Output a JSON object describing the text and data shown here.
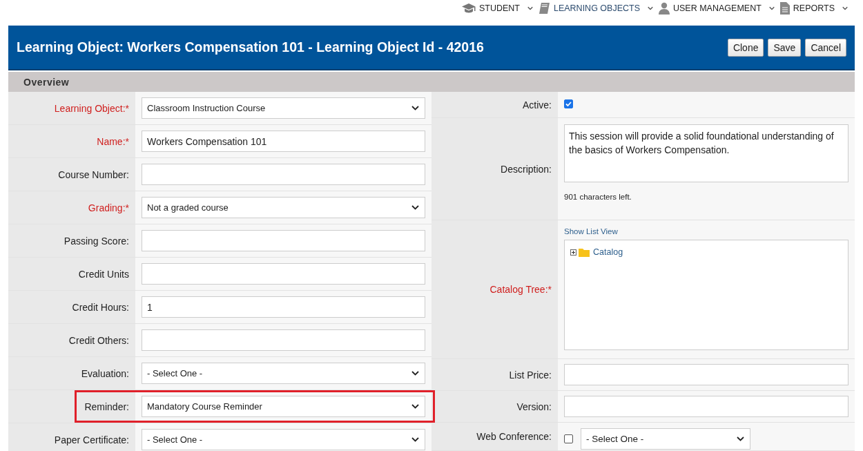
{
  "nav": [
    {
      "label": "STUDENT",
      "selected": false
    },
    {
      "label": "LEARNING OBJECTS",
      "selected": true
    },
    {
      "label": "USER MANAGEMENT",
      "selected": false
    },
    {
      "label": "REPORTS",
      "selected": false
    }
  ],
  "header": {
    "title": "Learning Object: Workers Compensation 101 - Learning Object Id - 42016",
    "buttons": [
      "Clone",
      "Save",
      "Cancel"
    ]
  },
  "section": "Overview",
  "left_fields": [
    {
      "label": "Learning Object:*",
      "required": true,
      "kind": "select",
      "value": "Classroom Instruction Course",
      "highlighted": false
    },
    {
      "label": "Name:*",
      "required": true,
      "kind": "text",
      "value": "Workers Compensation 101",
      "highlighted": false
    },
    {
      "label": "Course Number:",
      "required": false,
      "kind": "text",
      "highlighted": false
    },
    {
      "label": "Grading:*",
      "required": true,
      "kind": "select",
      "value": "Not a graded course",
      "highlighted": false
    },
    {
      "label": "Passing Score:",
      "required": false,
      "kind": "text",
      "highlighted": false
    },
    {
      "label": "Credit Units",
      "required": false,
      "kind": "text",
      "highlighted": false
    },
    {
      "label": "Credit Hours:",
      "required": false,
      "kind": "text",
      "value": "1",
      "highlighted": false
    },
    {
      "label": "Credit Others:",
      "required": false,
      "kind": "text",
      "highlighted": false
    },
    {
      "label": "Evaluation:",
      "required": false,
      "kind": "select",
      "value": "- Select One -",
      "highlighted": false
    },
    {
      "label": "Reminder:",
      "required": false,
      "kind": "select",
      "value": "Mandatory Course Reminder",
      "highlighted": true
    },
    {
      "label": "Paper Certificate:",
      "required": false,
      "kind": "select",
      "value": "- Select One -",
      "highlighted": false
    }
  ],
  "right_fields": [
    {
      "label": "Active:",
      "required": false,
      "kind": "checkbox",
      "checked": true
    },
    {
      "label": "Description:",
      "required": false,
      "kind": "textarea",
      "value": "This session will provide a solid foundational understanding of the basics of Workers Compensation.",
      "note": "901 characters left."
    },
    {
      "label": "Catalog Tree:*",
      "required": true,
      "kind": "tree",
      "link": "Show List View",
      "tree": [
        {
          "label": "Catalog",
          "expanded": false
        }
      ]
    },
    {
      "label": "List Price:",
      "required": false,
      "kind": "text"
    },
    {
      "label": "Version:",
      "required": false,
      "kind": "text"
    },
    {
      "label": "Web Conference:",
      "required": false,
      "kind": "checkbox_select",
      "checked": false,
      "value": "- Select One -"
    }
  ]
}
